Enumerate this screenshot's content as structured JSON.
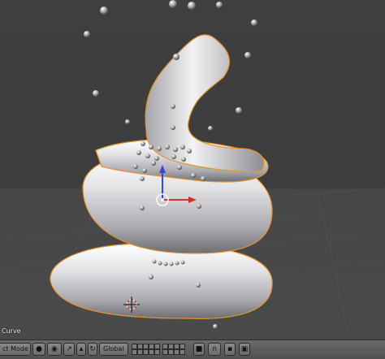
{
  "viewport": {
    "object_label": "Curve"
  },
  "header": {
    "mode_label": "ct Mode",
    "orientation_label": "Global",
    "icons": [
      "view-menu-icon",
      "viewport-shading-icon",
      "pivot-icon",
      "manipulator-icon",
      "orientation-icon",
      "layers-icon",
      "lock-icon",
      "render-icon"
    ]
  }
}
